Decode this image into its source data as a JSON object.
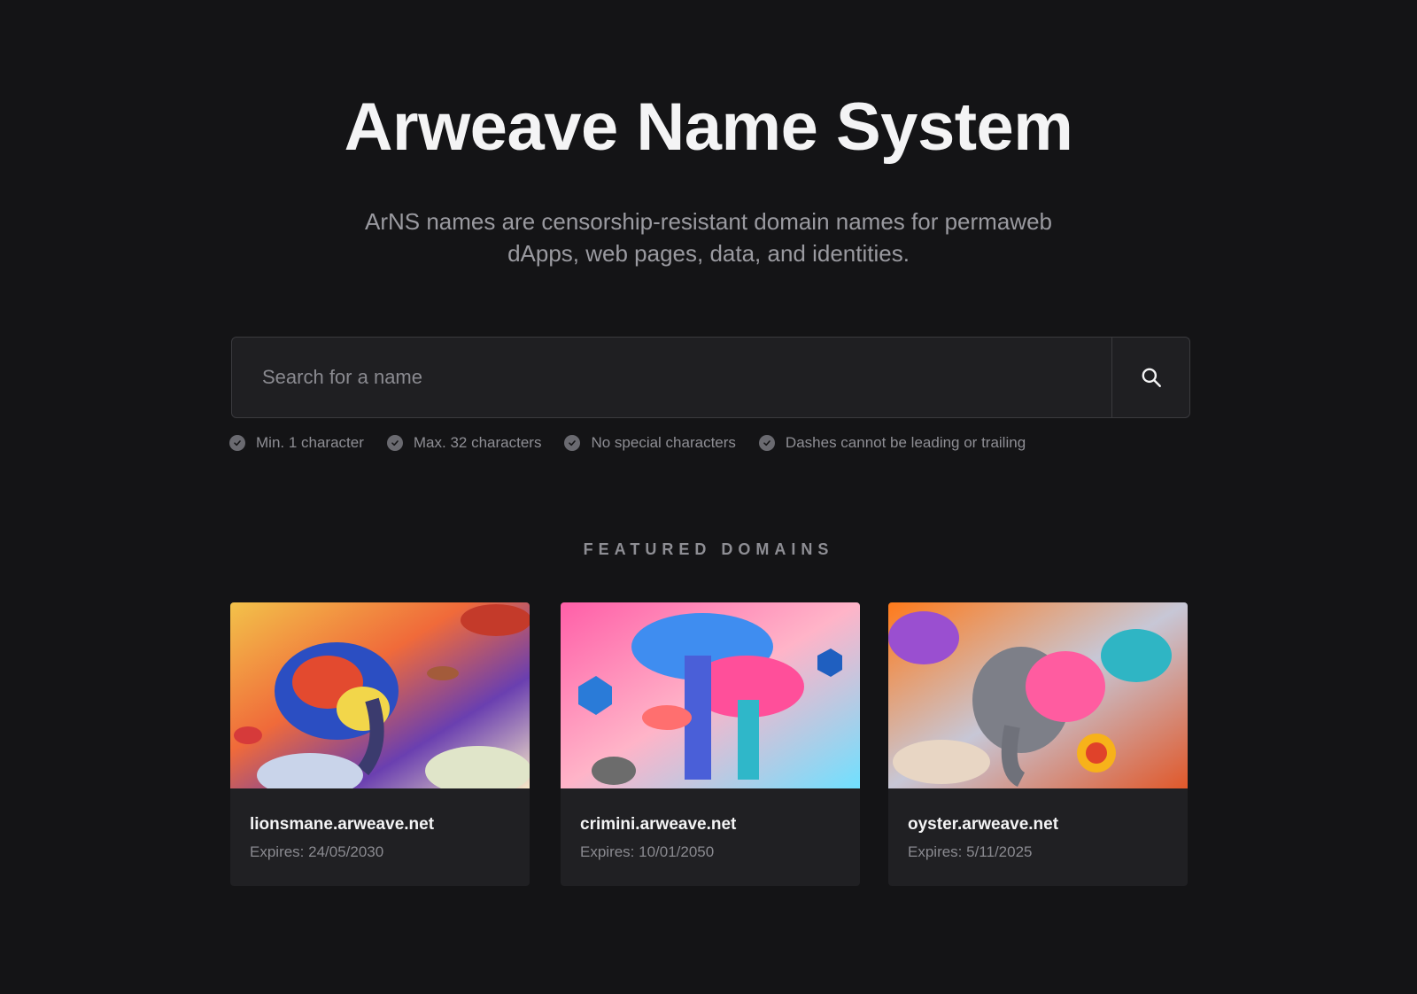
{
  "hero": {
    "title": "Arweave Name System",
    "subtitle": "ArNS names are censorship-resistant domain names for permaweb dApps, web pages, data, and identities."
  },
  "search": {
    "placeholder": "Search for a name",
    "value": "",
    "button_icon": "search-icon"
  },
  "rules": [
    {
      "label": "Min. 1 character",
      "icon": "check-circle-icon"
    },
    {
      "label": "Max. 32 characters",
      "icon": "check-circle-icon"
    },
    {
      "label": "No special characters",
      "icon": "check-circle-icon"
    },
    {
      "label": "Dashes cannot be leading or trailing",
      "icon": "check-circle-icon"
    }
  ],
  "featured": {
    "heading": "FEATURED DOMAINS",
    "cards": [
      {
        "name": "lionsmane.arweave.net",
        "expires": "Expires: 24/05/2030",
        "image": "psychedelic-elephant-mushrooms-art"
      },
      {
        "name": "crimini.arweave.net",
        "expires": "Expires: 10/01/2050",
        "image": "neon-mushrooms-crypto-art"
      },
      {
        "name": "oyster.arweave.net",
        "expires": "Expires: 5/11/2025",
        "image": "swirling-elephant-mushrooms-art"
      }
    ]
  },
  "colors": {
    "background": "#141416",
    "card": "#202023",
    "muted_text": "#8e8e94"
  }
}
